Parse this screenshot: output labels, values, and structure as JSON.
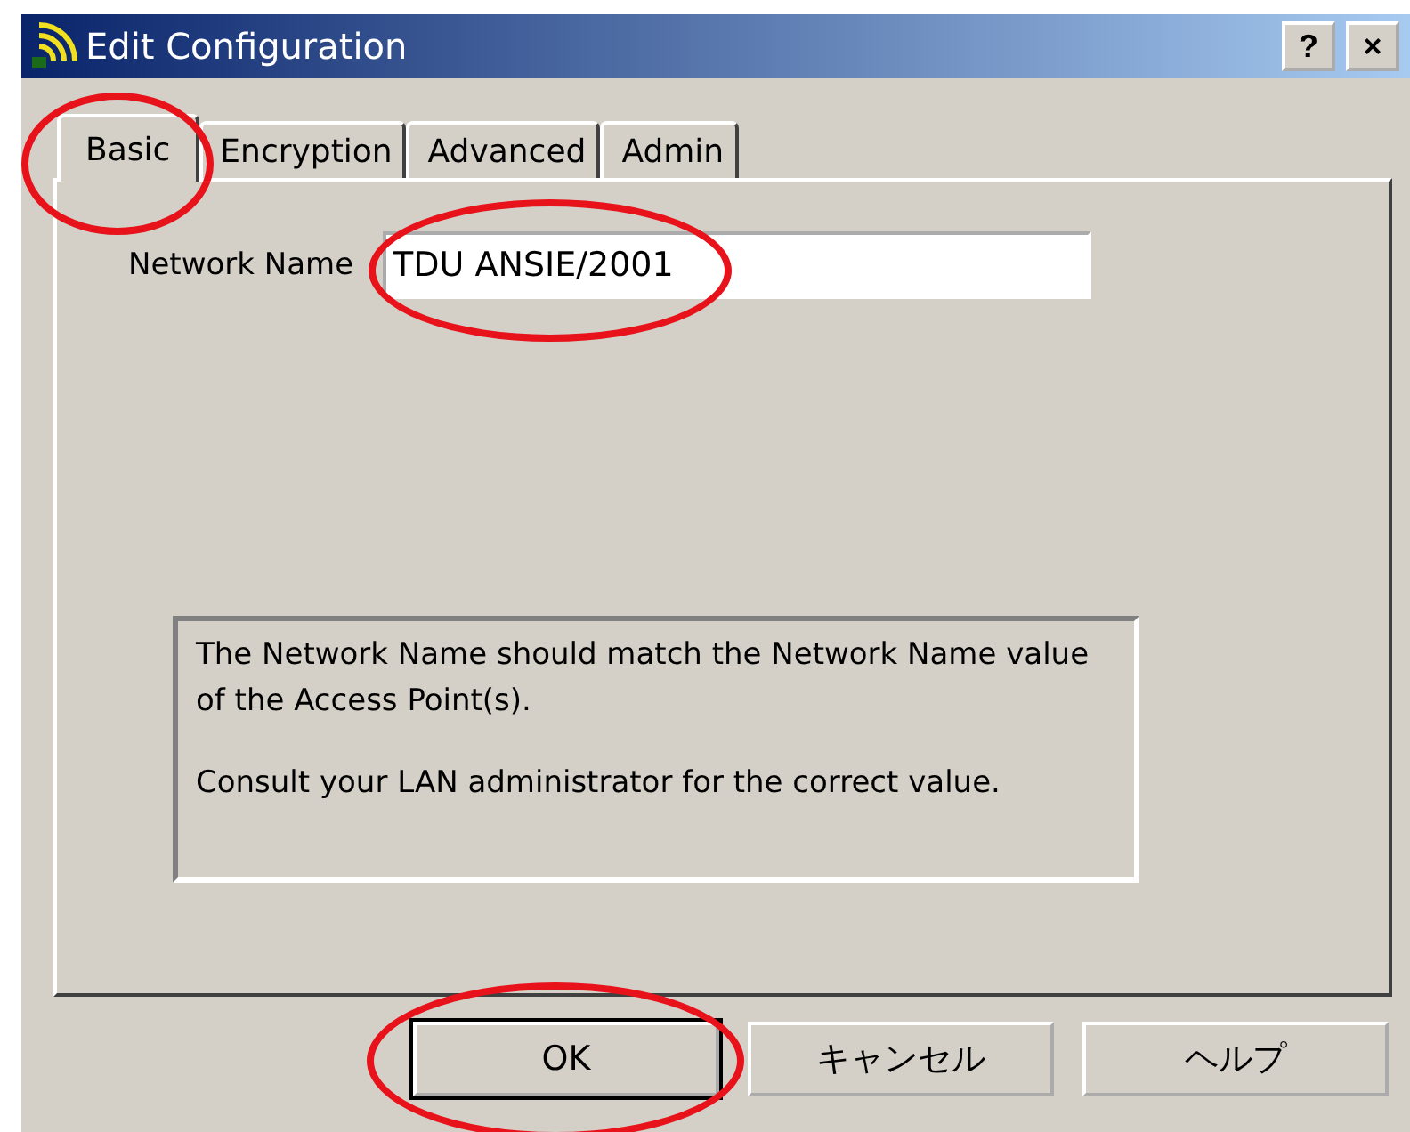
{
  "window": {
    "title": "Edit Configuration",
    "title_buttons": [
      "?",
      "×"
    ]
  },
  "tabs": [
    {
      "label": "Basic",
      "selected": true,
      "circled": true
    },
    {
      "label": "Encryption",
      "selected": false,
      "circled": false
    },
    {
      "label": "Advanced",
      "selected": false,
      "circled": false
    },
    {
      "label": "Admin",
      "selected": false,
      "circled": false
    }
  ],
  "network_name": {
    "label": "Network Name",
    "value": "TDU ANSIE/2001",
    "circled": true
  },
  "info": [
    "The Network Name should match the Network Name value of the Access Point(s).",
    "Consult your LAN administrator for the correct value."
  ],
  "buttons": [
    {
      "label": "OK",
      "default": true,
      "circled": true
    },
    {
      "label": "キャンセル",
      "default": false,
      "circled": false
    },
    {
      "label": "ヘルプ",
      "default": false,
      "circled": false
    }
  ]
}
